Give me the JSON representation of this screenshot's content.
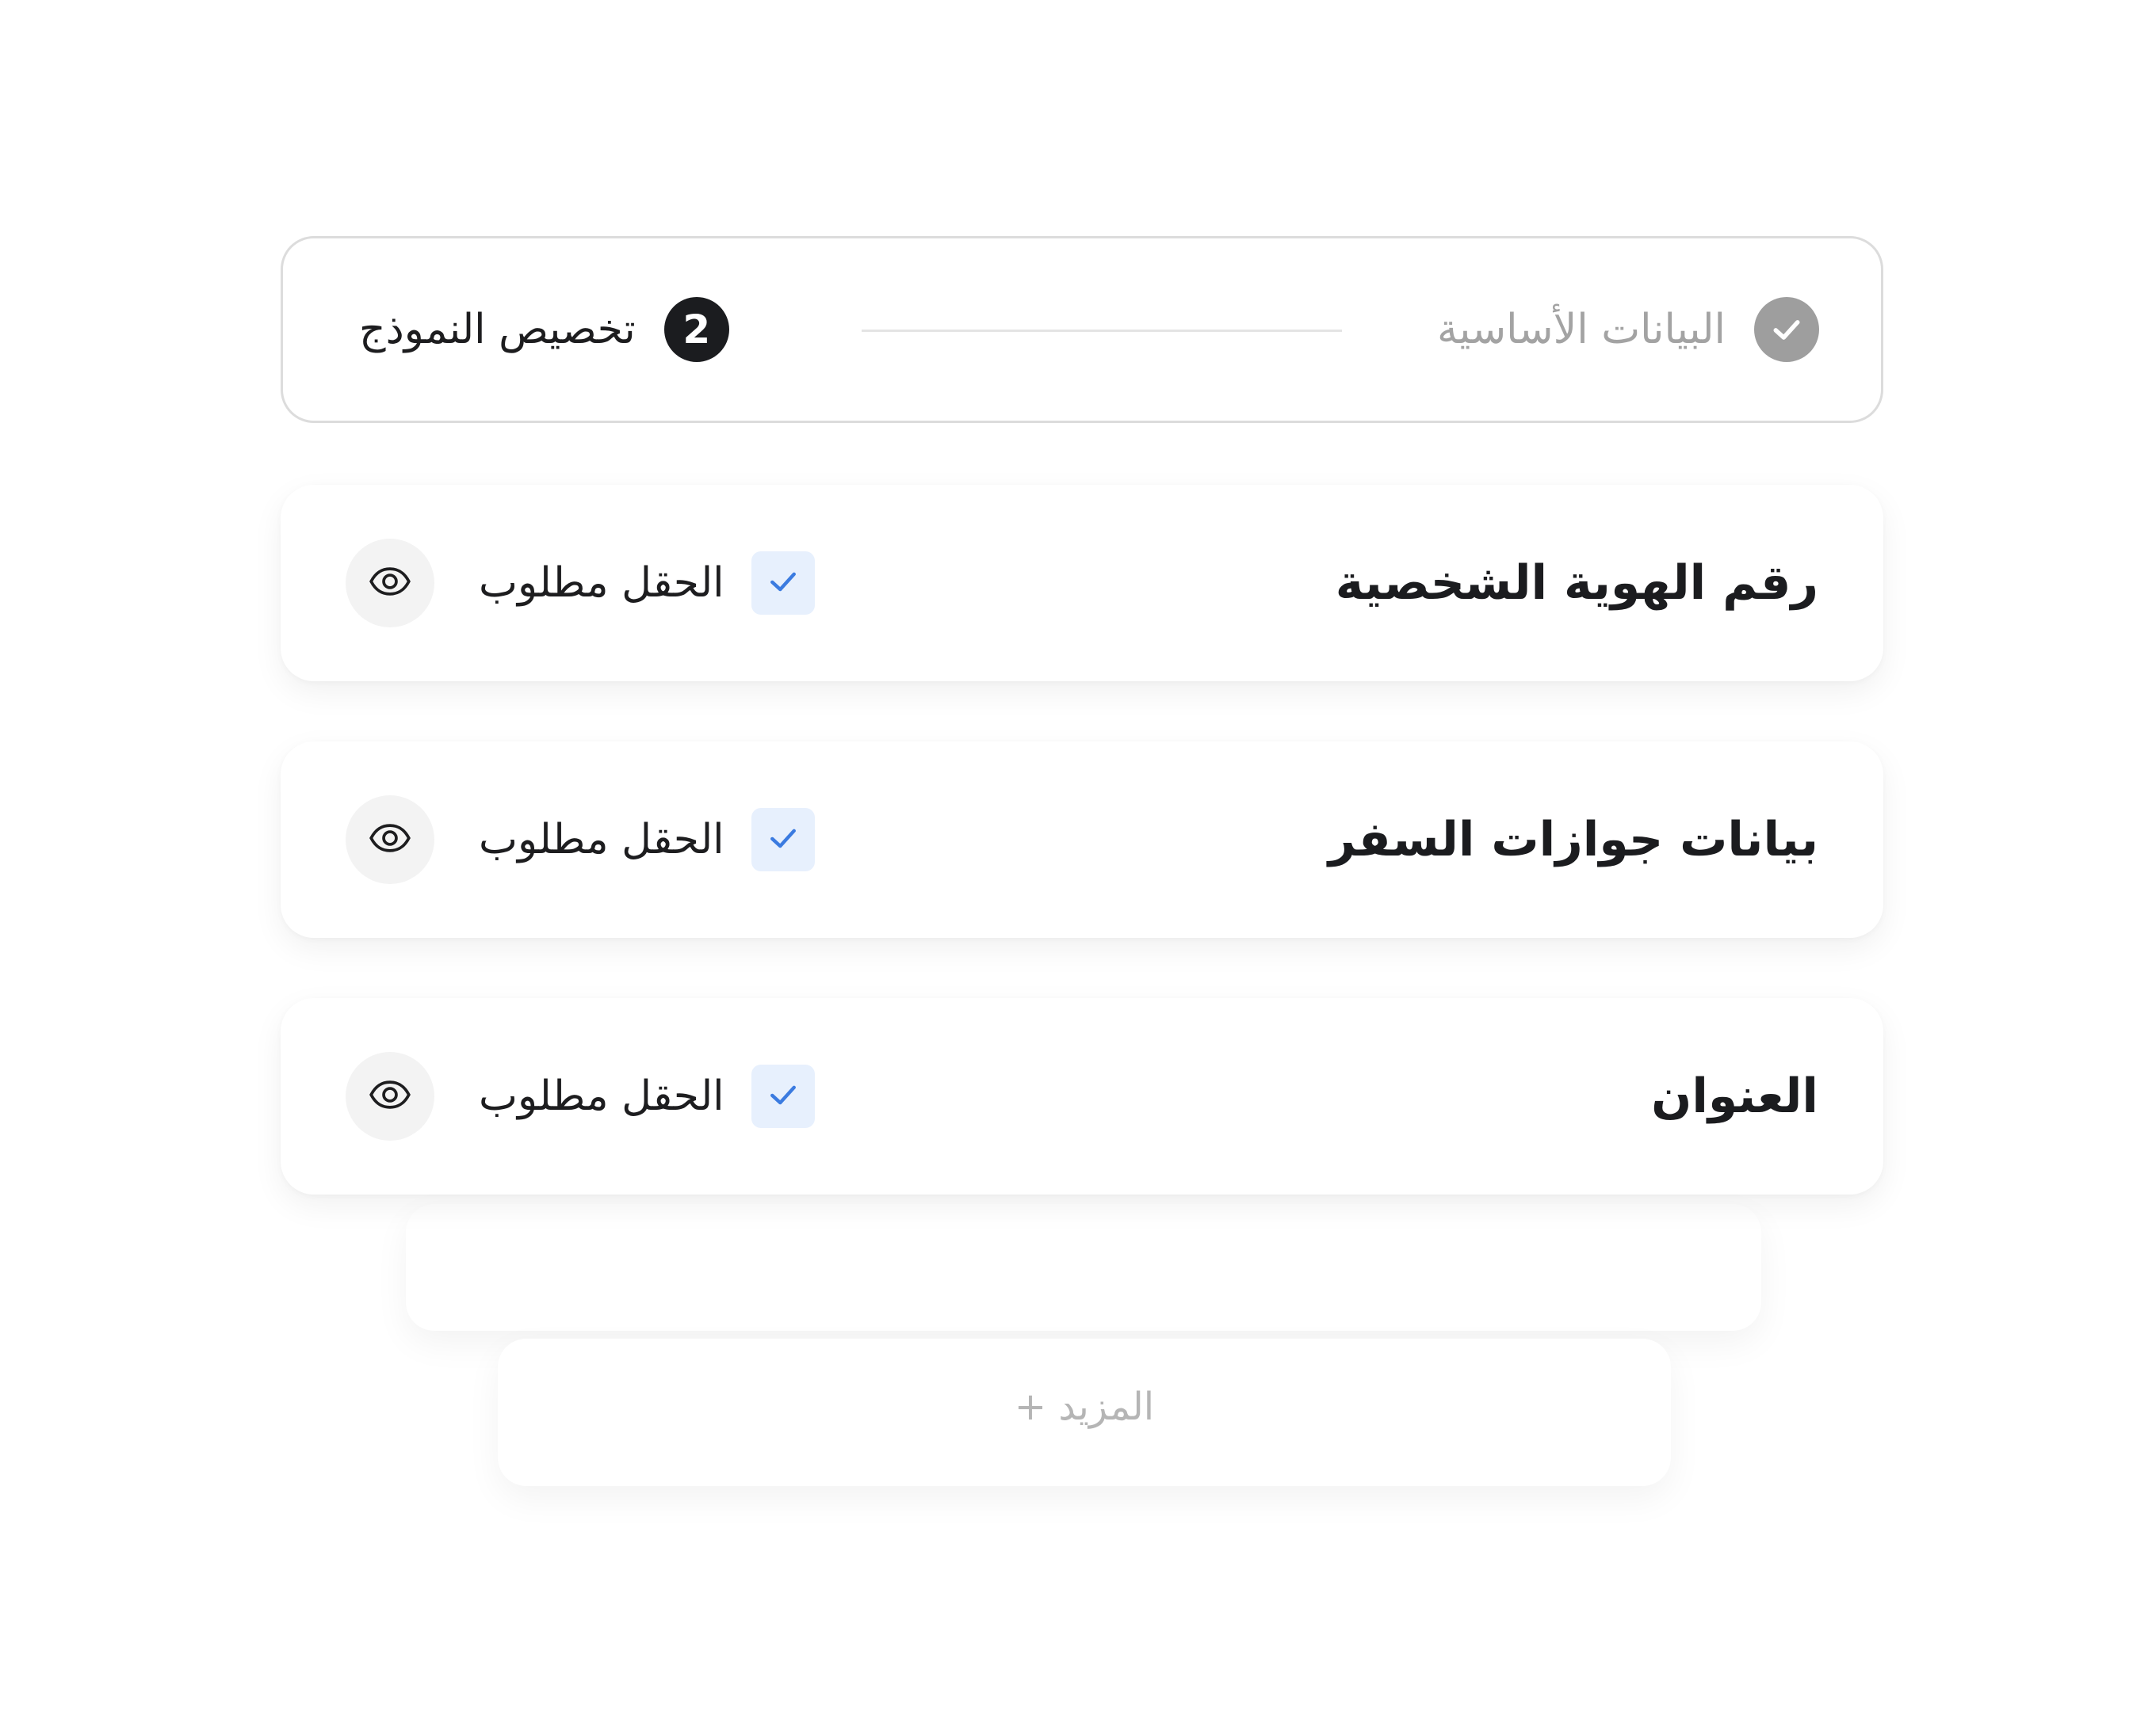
{
  "stepper": {
    "steps": [
      {
        "label": "البيانات الأساسية",
        "status": "done",
        "icon": "check-icon"
      },
      {
        "label": "تخصيص النموذج",
        "status": "current",
        "number": "2"
      }
    ]
  },
  "fields": [
    {
      "title": "رقم الهوية الشخصية",
      "required_label": "الحقل مطلوب",
      "required": true
    },
    {
      "title": "بيانات جوازات السفر",
      "required_label": "الحقل مطلوب",
      "required": true
    },
    {
      "title": "العنوان",
      "required_label": "الحقل مطلوب",
      "required": true
    }
  ],
  "more": {
    "label": "المزيد +"
  },
  "colors": {
    "step_done": "#9e9e9e",
    "step_current": "#1b1c1f",
    "checkbox_bg": "#e7f0fd",
    "check_mark": "#3b7be0",
    "eye_bg": "#f3f3f3"
  }
}
